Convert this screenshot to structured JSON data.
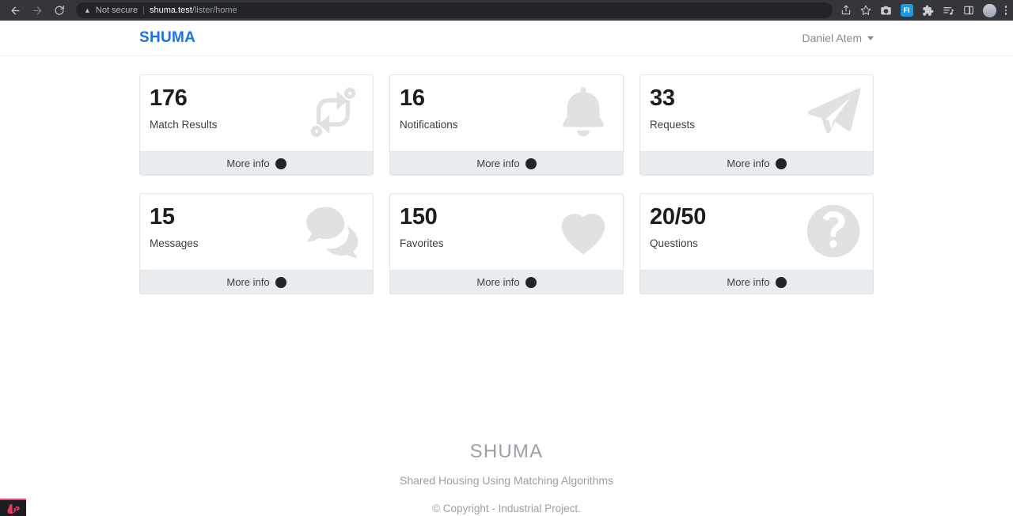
{
  "browser": {
    "back_icon": "back-arrow-icon",
    "forward_icon": "forward-arrow-icon",
    "reload_icon": "reload-icon",
    "security_label": "Not secure",
    "url_host": "shuma.test",
    "url_path": "/lister/home",
    "extension_badge": "FI",
    "icons": [
      "share-icon",
      "bookmark-star-icon",
      "camera-icon",
      "extension-badge-icon",
      "puzzle-extensions-icon",
      "reading-list-icon",
      "side-panel-icon",
      "profile-avatar-icon",
      "chrome-menu-icon"
    ]
  },
  "header": {
    "brand": "SHUMA",
    "user_name": "Daniel Atem"
  },
  "cards": [
    {
      "value": "176",
      "label": "Match Results",
      "icon": "code-branch-icon",
      "action": "More info"
    },
    {
      "value": "16",
      "label": "Notifications",
      "icon": "bell-icon",
      "action": "More info"
    },
    {
      "value": "33",
      "label": "Requests",
      "icon": "paper-plane-icon",
      "action": "More info"
    },
    {
      "value": "15",
      "label": "Messages",
      "icon": "speech-bubbles-icon",
      "action": "More info"
    },
    {
      "value": "150",
      "label": "Favorites",
      "icon": "heart-icon",
      "action": "More info"
    },
    {
      "value": "20/50",
      "label": "Questions",
      "icon": "question-circle-icon",
      "action": "More info"
    }
  ],
  "footer": {
    "brand": "SHUMA",
    "tagline": "Shared Housing Using Matching Algorithms",
    "copyright": "© Copyright - Industrial Project."
  },
  "colors": {
    "brand_blue": "#1a73e8",
    "card_icon_gray": "#e0e1e2",
    "card_foot_bg": "#e9ecef",
    "footer_text": "#9aa0a6"
  }
}
